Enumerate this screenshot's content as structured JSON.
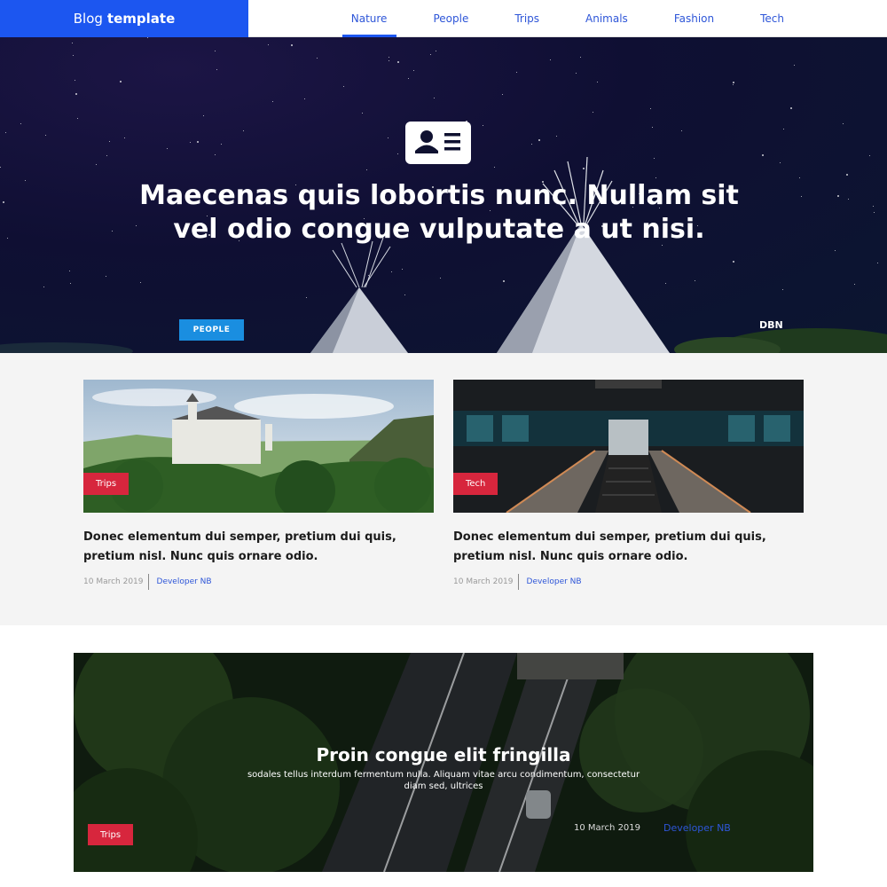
{
  "header": {
    "brand_light": "Blog",
    "brand_bold": "template",
    "nav": [
      "Nature",
      "People",
      "Trips",
      "Animals",
      "Fashion",
      "Tech"
    ],
    "active": "Nature"
  },
  "hero": {
    "icon": "id-card-icon",
    "title": "Maecenas quis lobortis nunc. Nullam sit vel odio congue vulputate a ut nisi.",
    "badge": "PEOPLE",
    "author": "DBN"
  },
  "cards": [
    {
      "tag": "Trips",
      "title": "Donec elementum dui semper, pretium dui quis, pretium nisl. Nunc quis ornare odio.",
      "date": "10 March 2019",
      "author": "Developer NB"
    },
    {
      "tag": "Tech",
      "title": "Donec elementum dui semper, pretium dui quis, pretium nisl. Nunc quis ornare odio.",
      "date": "10 March 2019",
      "author": "Developer NB"
    }
  ],
  "feature": {
    "title": "Proin congue elit fringilla",
    "subtitle": "sodales tellus interdum fermentum nulla. Aliquam vitae arcu condimentum, consectetur diam sed, ultrices",
    "tag": "Trips",
    "date": "10 March 2019",
    "author": "Developer NB"
  },
  "colors": {
    "brand": "#1c56f0",
    "link": "#2e56d8",
    "badge_blue": "#1a8ee0",
    "tag_red": "#d7263d"
  }
}
